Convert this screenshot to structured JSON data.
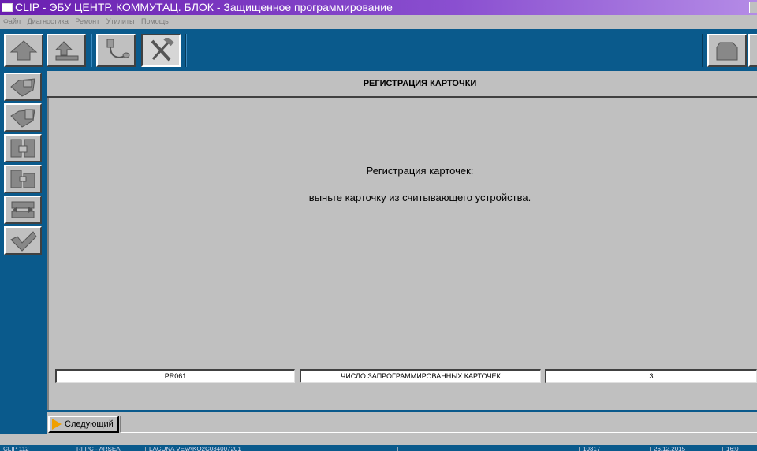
{
  "window": {
    "title": "CLIP - ЭБУ ЦЕНТР. КОММУТАЦ. БЛОК - Защищенное программирование"
  },
  "menu": {
    "items": [
      "Файл",
      "Диагностика",
      "Ремонт",
      "Утилиты",
      "Помощь"
    ]
  },
  "toolbar": {
    "buttons": [
      {
        "icon": "home-arrow-icon"
      },
      {
        "icon": "up-level-icon"
      },
      {
        "icon": "diagnostic-cable-icon"
      },
      {
        "icon": "tools-icon",
        "pressed": true
      },
      {
        "icon": "print-icon"
      }
    ]
  },
  "sidebar": {
    "buttons": [
      {
        "icon": "vehicle-id-icon"
      },
      {
        "icon": "vehicle-check-icon"
      },
      {
        "icon": "parts-icon"
      },
      {
        "icon": "parts-replace-icon"
      },
      {
        "icon": "configuration-icon"
      },
      {
        "icon": "validate-icon"
      }
    ]
  },
  "content": {
    "header": "РЕГИСТРАЦИЯ КАРТОЧКИ",
    "message_line1": "Регистрация карточек:",
    "message_line2": "выньте карточку из считывающего устройства."
  },
  "fields": {
    "code": "PR061",
    "label": "ЧИСЛО ЗАПРОГРАММИРОВАННЫХ КАРТОЧЕК",
    "value": "3"
  },
  "nav": {
    "next_label": "Следующий"
  },
  "statusbar": {
    "cells": [
      "CLIP 112",
      "RFPC - ARSEA",
      "LACUNA VEVAKO2C034007201",
      "",
      "10317",
      "26.12.2015",
      "16:0"
    ]
  },
  "colors": {
    "frame": "#0a5a8c",
    "panel": "#c0c0c0",
    "title_gradient_start": "#6a1fb0",
    "next_arrow": "#f0a000"
  }
}
